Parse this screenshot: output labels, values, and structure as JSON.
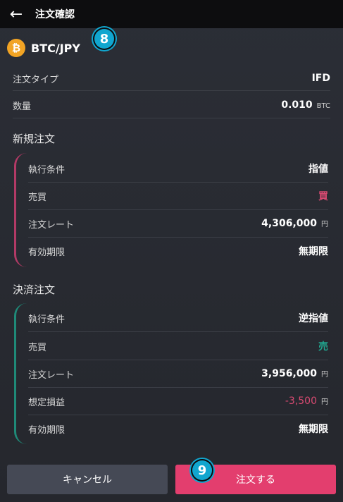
{
  "header": {
    "title": "注文確認"
  },
  "pair": {
    "coin_symbol": "₿",
    "label": "BTC/JPY"
  },
  "markers": {
    "m1": "8",
    "m2": "9"
  },
  "summary": {
    "order_type_label": "注文タイプ",
    "order_type_value": "IFD",
    "quantity_label": "数量",
    "quantity_value": "0.010",
    "quantity_unit": "BTC"
  },
  "new_order": {
    "title": "新規注文",
    "rows": [
      {
        "label": "執行条件",
        "value": "指値"
      },
      {
        "label": "売買",
        "value": "買"
      },
      {
        "label": "注文レート",
        "value": "4,306,000",
        "unit": "円"
      },
      {
        "label": "有効期限",
        "value": "無期限"
      }
    ]
  },
  "settle_order": {
    "title": "決済注文",
    "rows": [
      {
        "label": "執行条件",
        "value": "逆指値"
      },
      {
        "label": "売買",
        "value": "売"
      },
      {
        "label": "注文レート",
        "value": "3,956,000",
        "unit": "円"
      },
      {
        "label": "想定損益",
        "value": "-3,500",
        "unit": "円"
      },
      {
        "label": "有効期限",
        "value": "無期限"
      }
    ]
  },
  "buttons": {
    "cancel": "キャンセル",
    "submit": "注文する"
  },
  "colors": {
    "buy": "#d94a72",
    "sell": "#21a690",
    "loss": "#d94a72",
    "new_bar": "#b23a66",
    "settle_bar": "#1f8a78"
  }
}
